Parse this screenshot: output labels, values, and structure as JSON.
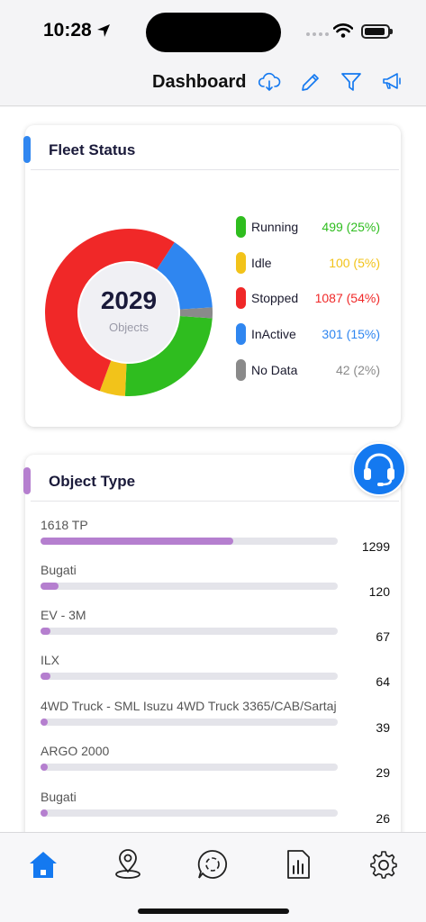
{
  "status_bar": {
    "time": "10:28"
  },
  "header": {
    "title": "Dashboard",
    "icons": [
      "cloud-download-icon",
      "pencil-icon",
      "filter-icon",
      "megaphone-icon"
    ],
    "accent_color": "#1479f0"
  },
  "fleet_status": {
    "title": "Fleet Status",
    "accent_color": "#2f86f0",
    "total": "2029",
    "total_label": "Objects",
    "items": [
      {
        "label": "Running",
        "value": "499 (25%)",
        "count": 499,
        "color": "#2fbd1f"
      },
      {
        "label": "Idle",
        "value": "100 (5%)",
        "count": 100,
        "color": "#f2c31a"
      },
      {
        "label": "Stopped",
        "value": "1087 (54%)",
        "count": 1087,
        "color": "#f02828"
      },
      {
        "label": "InActive",
        "value": "301 (15%)",
        "count": 301,
        "color": "#2f86f0"
      },
      {
        "label": "No Data",
        "value": "42 (2%)",
        "count": 42,
        "color": "#8a8a8a"
      }
    ]
  },
  "object_type": {
    "title": "Object Type",
    "accent_color": "#b57fcf",
    "max": 1999,
    "items": [
      {
        "name": "1618 TP",
        "count": "1299",
        "value": 1299
      },
      {
        "name": "Bugati",
        "count": "120",
        "value": 120
      },
      {
        "name": "EV - 3M",
        "count": "67",
        "value": 67
      },
      {
        "name": "ILX",
        "count": "64",
        "value": 64
      },
      {
        "name": "4WD Truck - SML Isuzu 4WD Truck 3365/CAB/Sartaj",
        "count": "39",
        "value": 39
      },
      {
        "name": "ARGO 2000",
        "count": "29",
        "value": 29
      },
      {
        "name": "Bugati",
        "count": "26",
        "value": 26
      }
    ]
  },
  "tabbar": {
    "items": [
      "home-icon",
      "location-pin-icon",
      "chat-icon",
      "report-icon",
      "settings-icon"
    ],
    "active_color": "#1479f0"
  }
}
